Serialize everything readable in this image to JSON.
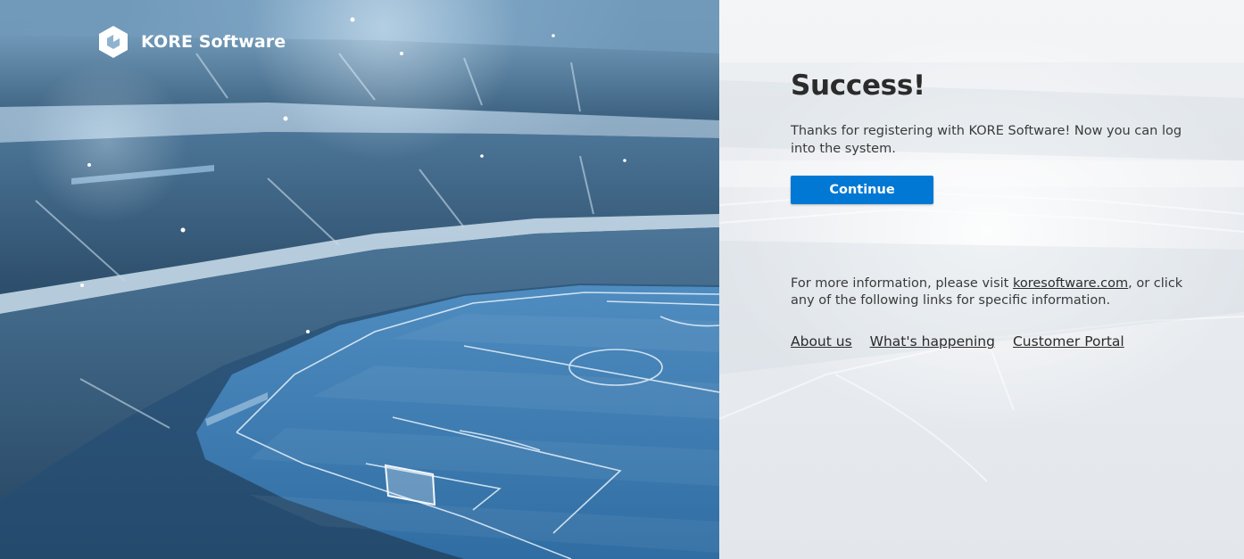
{
  "brand": {
    "name": "KORE Software",
    "logo_icon": "kore-hexagon-icon"
  },
  "hero": {
    "image": "stadium-photo"
  },
  "content": {
    "title": "Success!",
    "message": "Thanks for registering with KORE Software! Now you can log into the system.",
    "continue_label": "Continue",
    "info_prefix": "For more information, please visit ",
    "info_link": "koresoftware.com",
    "info_suffix": ", or click any of the following links for specific information.",
    "links": [
      {
        "label": "About us"
      },
      {
        "label": "What's happening"
      },
      {
        "label": "Customer Portal"
      }
    ]
  },
  "colors": {
    "accent": "#0078d4",
    "title": "#2b2b2b",
    "text": "#3a3a3a"
  }
}
